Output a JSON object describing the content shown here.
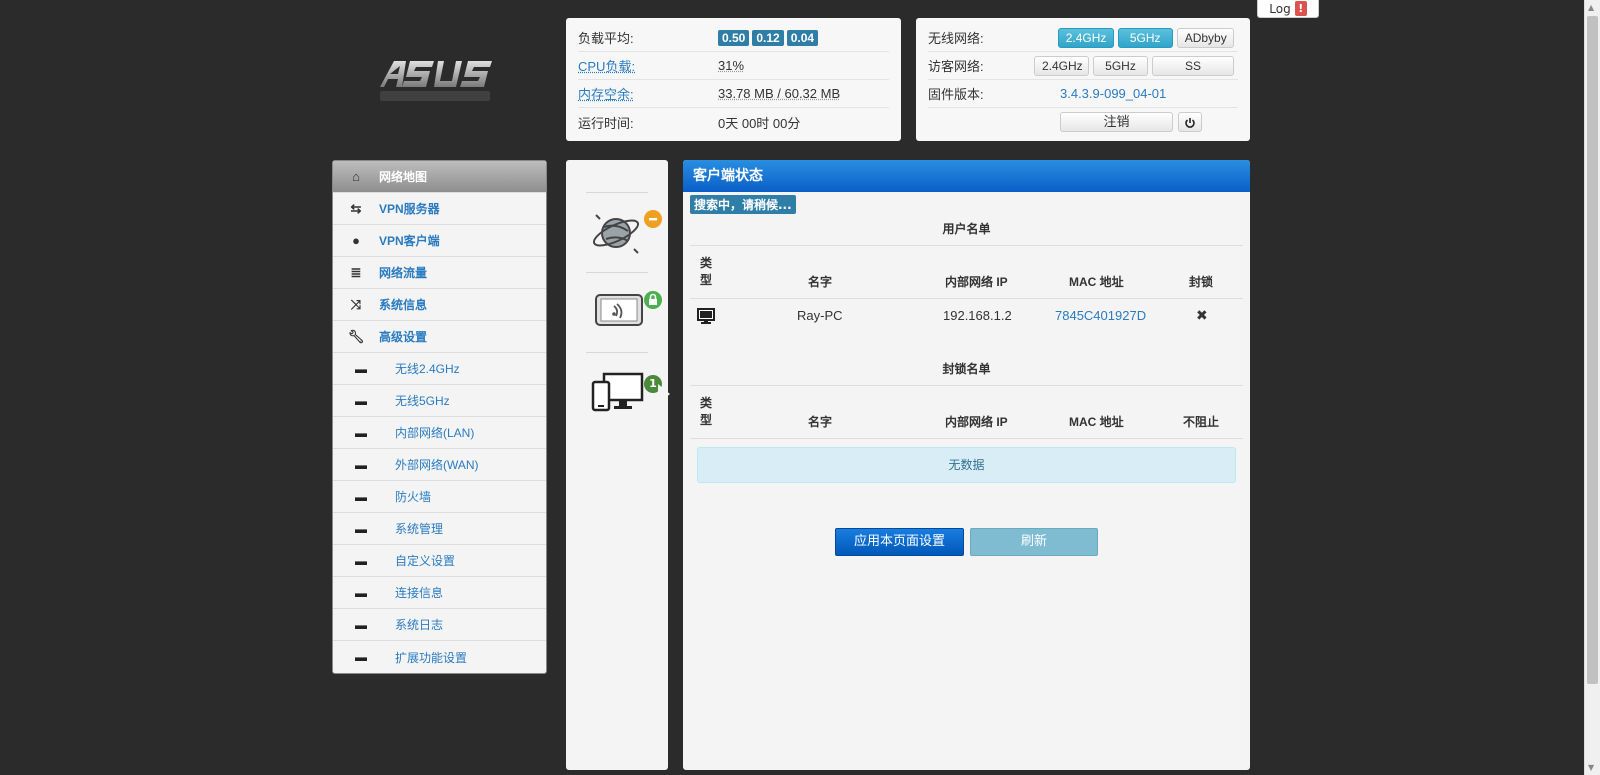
{
  "header": {
    "log_label": "Log",
    "log_alert": "!"
  },
  "status": {
    "load_label": "负载平均:",
    "load_values": [
      "0.50",
      "0.12",
      "0.04"
    ],
    "cpu_label": "CPU负载:",
    "cpu_value": "31%",
    "mem_label": "内存空余:",
    "mem_value": "33.78 MB / 60.32 MB",
    "uptime_label": "运行时间:",
    "uptime_value": "0天 00时 00分"
  },
  "wireless": {
    "wifi_label": "无线网络:",
    "wifi_buttons": [
      "2.4GHz",
      "5GHz",
      "ADbyby"
    ],
    "guest_label": "访客网络:",
    "guest_buttons": [
      "2.4GHz",
      "5GHz",
      "SS"
    ],
    "firmware_label": "固件版本:",
    "firmware_value": "3.4.3.9-099_04-01",
    "logout_label": "注销"
  },
  "menu": {
    "items": [
      {
        "label": "网络地图",
        "icon": "home-icon"
      },
      {
        "label": "VPN服务器",
        "icon": "vpn-server-icon"
      },
      {
        "label": "VPN客户端",
        "icon": "globe-icon"
      },
      {
        "label": "网络流量",
        "icon": "traffic-icon"
      },
      {
        "label": "系统信息",
        "icon": "shuffle-icon"
      },
      {
        "label": "高级设置",
        "icon": "wrench-icon"
      }
    ],
    "subitems": [
      "无线2.4GHz",
      "无线5GHz",
      "内部网络(LAN)",
      "外部网络(WAN)",
      "防火墙",
      "系统管理",
      "自定义设置",
      "连接信息",
      "系统日志",
      "扩展功能设置"
    ]
  },
  "iconcol": {
    "client_count": "1"
  },
  "main": {
    "title": "客户端状态",
    "searching": "搜索中，请稍候...",
    "user_list_title": "用户名单",
    "block_list_title": "封锁名单",
    "user_headers": {
      "type": "类型",
      "name": "名字",
      "ip": "内部网络 IP",
      "mac": "MAC 地址",
      "action": "封锁"
    },
    "block_headers": {
      "type": "类型",
      "name": "名字",
      "ip": "内部网络 IP",
      "mac": "MAC 地址",
      "action": "不阻止"
    },
    "clients": [
      {
        "name": "Ray-PC",
        "ip": "192.168.1.2",
        "mac": "7845C401927D",
        "action": "✖"
      }
    ],
    "no_data": "无数据",
    "apply_label": "应用本页面设置",
    "refresh_label": "刷新"
  },
  "colors": {
    "accent": "#2a7bc0",
    "header_blue": "#0a5fc8",
    "badge_blue": "#2e7ea7"
  }
}
